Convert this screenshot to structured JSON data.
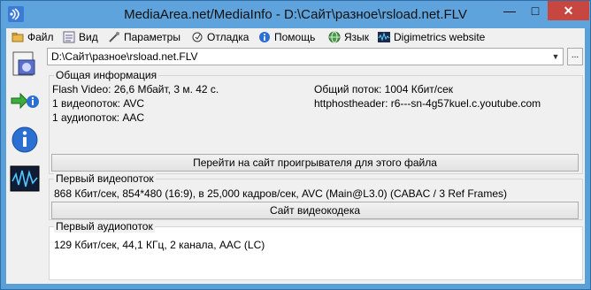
{
  "window": {
    "title": "MediaArea.net/MediaInfo - D:\\Сайт\\разное\\rsload.net.FLV",
    "minimize": "—",
    "maximize": "□",
    "close": "✕"
  },
  "menu": {
    "file": "Файл",
    "view": "Вид",
    "params": "Параметры",
    "debug": "Отладка",
    "help": "Помощь",
    "lang": "Язык",
    "digimetrics": "Digimetrics website"
  },
  "file_combo": {
    "value": "D:\\Сайт\\разное\\rsload.net.FLV",
    "arrow": "▼",
    "more": "..."
  },
  "general": {
    "title": "Общая информация",
    "format_line": "Flash Video: 26,6 Мбайт, 3 м. 42 с.",
    "video_count": "1 видеопоток: AVC",
    "audio_count": "1 аудиопоток: AAC",
    "overall_bitrate": "Общий поток: 1004 Кбит/сек",
    "httphost": "httphostheader: r6---sn-4g57kuel.c.youtube.com",
    "player_button": "Перейти на сайт проигрывателя для этого файла"
  },
  "video": {
    "title": "Первый видеопоток",
    "details": "868 Кбит/сек, 854*480 (16:9), в 25,000 кадров/сек, AVC (Main@L3.0) (CABAC / 3 Ref Frames)",
    "codec_button": "Сайт видеокодека"
  },
  "audio": {
    "title": "Первый аудиопоток",
    "details": "129 Кбит/сек, 44,1 КГц, 2 канала, AAC (LC)"
  },
  "colors": {
    "titlebar": "#5ea3dc",
    "close": "#c7463f",
    "background": "#f0f0f0"
  }
}
